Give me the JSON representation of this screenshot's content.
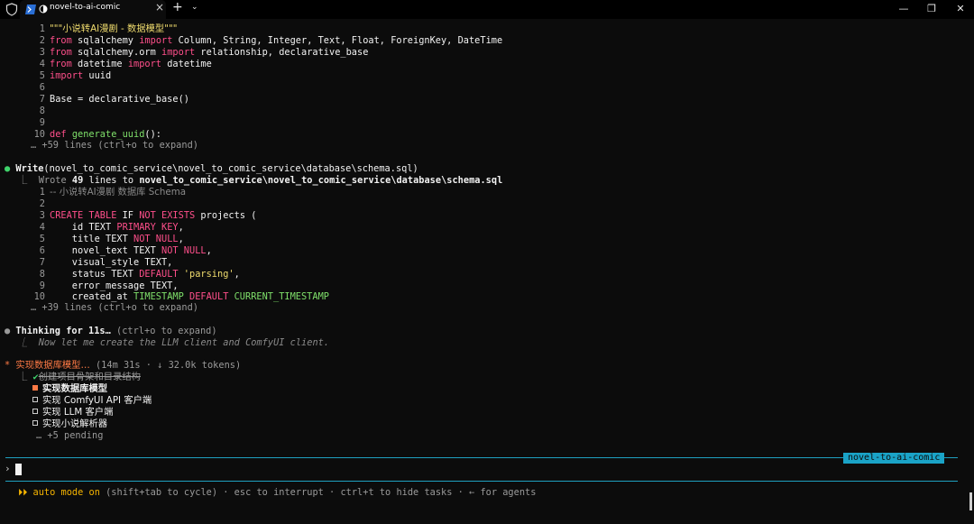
{
  "window": {
    "tab_title": "novel-to-ai-comic",
    "tab_close": "×",
    "new_tab": "+",
    "dropdown": "⌄",
    "minimize": "—",
    "maximize": "❐",
    "close": "✕"
  },
  "block1": {
    "lines": [
      {
        "n": "1",
        "t": "\"\"\"小说转AI漫剧 - 数据模型\"\"\""
      },
      {
        "n": "2",
        "kw1": "from",
        "a": " sqlalchemy ",
        "kw2": "import",
        "b": " Column, String, Integer, Text, Float, ForeignKey, DateTime"
      },
      {
        "n": "3",
        "kw1": "from",
        "a": " sqlalchemy.orm ",
        "kw2": "import",
        "b": " relationship, declarative_base"
      },
      {
        "n": "4",
        "kw1": "from",
        "a": " datetime ",
        "kw2": "import",
        "b": " datetime"
      },
      {
        "n": "5",
        "kw1": "import",
        "a": " uuid"
      },
      {
        "n": "6"
      },
      {
        "n": "7",
        "a": "Base = declarative_base()"
      },
      {
        "n": "8"
      },
      {
        "n": "9"
      },
      {
        "n": "10",
        "kw1": "def",
        "fn": "generate_uuid",
        "b": "():"
      }
    ],
    "more": "… +59 lines (ctrl+o to expand)"
  },
  "write": {
    "bullet": "●",
    "label": "Write",
    "path": "(novel_to_comic_service\\novel_to_comic_service\\database\\schema.sql)",
    "result_prefix": "⎿  Wrote ",
    "result_count": "49",
    "result_mid": " lines to ",
    "result_path": "novel_to_comic_service\\novel_to_comic_service\\database\\schema.sql",
    "lines": [
      {
        "n": "1",
        "cm": "-- 小说转AI漫剧 数据库 Schema"
      },
      {
        "n": "2"
      },
      {
        "n": "3",
        "k1": "CREATE TABLE",
        "w1": " IF ",
        "k2": "NOT EXISTS",
        "w2": " projects ("
      },
      {
        "n": "4",
        "w1": "    id TEXT ",
        "k1": "PRIMARY KEY",
        "w2": ","
      },
      {
        "n": "5",
        "w1": "    title TEXT ",
        "k1": "NOT NULL",
        "w2": ","
      },
      {
        "n": "6",
        "w1": "    novel_text TEXT ",
        "k1": "NOT NULL",
        "w2": ","
      },
      {
        "n": "7",
        "w1": "    visual_style TEXT,"
      },
      {
        "n": "8",
        "w1": "    status TEXT ",
        "k1": "DEFAULT",
        "s": " 'parsing'",
        "w2": ","
      },
      {
        "n": "9",
        "w1": "    error_message TEXT,"
      },
      {
        "n": "10",
        "w1": "    created_at ",
        "g1": "TIMESTAMP",
        "k1": " DEFAULT ",
        "g2": "CURRENT_TIMESTAMP"
      }
    ],
    "more": "… +39 lines (ctrl+o to expand)"
  },
  "thinking": {
    "bullet": "●",
    "label": "Thinking for 11s…",
    "hint": " (ctrl+o to expand)",
    "detail": "⎿  Now let me create the LLM client and ComfyUI client."
  },
  "task": {
    "star": "*",
    "title": "实现数据库模型…",
    "meta": " (14m 31s · ↓ 32.0k tokens)",
    "items": [
      {
        "label": "创建项目骨架和目录结构",
        "state": "done"
      },
      {
        "label": "实现数据库模型",
        "state": "active"
      },
      {
        "label": "实现 ComfyUI API 客户端",
        "state": "pending"
      },
      {
        "label": "实现 LLM 客户端",
        "state": "pending"
      },
      {
        "label": "实现小说解析器",
        "state": "pending"
      }
    ],
    "more": "… +5 pending"
  },
  "prompt": {
    "session_badge": "novel-to-ai-comic",
    "arrow": "›"
  },
  "status": {
    "arrows": "⏵⏵",
    "mode": " auto mode on",
    "rest": " (shift+tab to cycle) · esc to interrupt · ctrl+t to hide tasks · ← for agents"
  }
}
